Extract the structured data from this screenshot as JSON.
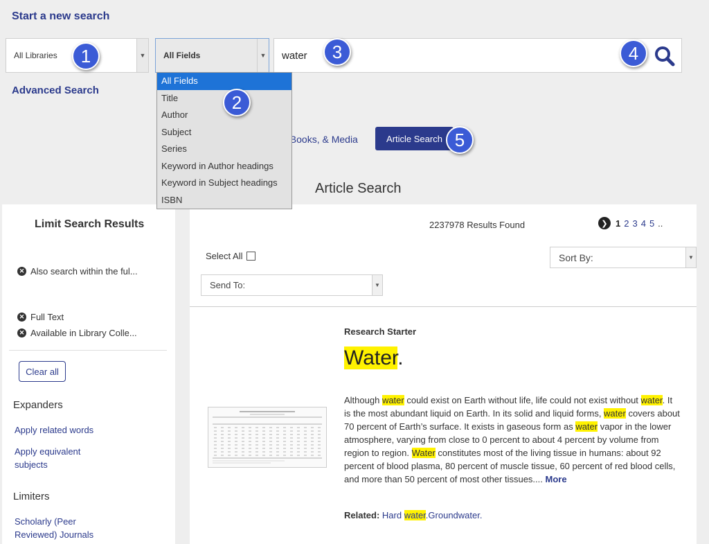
{
  "header": {
    "start_new_search": "Start a new search",
    "advanced_search": "Advanced Search"
  },
  "search": {
    "library_select": "All Libraries",
    "field_select": "All Fields",
    "query": "water",
    "field_options": [
      "All Fields",
      "Title",
      "Author",
      "Subject",
      "Series",
      "Keyword in Author headings",
      "Keyword in Subject headings",
      "ISBN"
    ]
  },
  "badges": [
    "1",
    "2",
    "3",
    "4",
    "5"
  ],
  "tabs": {
    "books_tab_partial": "eBooks, & Media",
    "article_search": "Article Search"
  },
  "section_title": "Article Search",
  "sidebar": {
    "title": "Limit Search Results",
    "chips": [
      "Also search within the ful...",
      "Full Text",
      "Available in Library Colle..."
    ],
    "clear_all": "Clear all",
    "expanders_heading": "Expanders",
    "expanders": [
      "Apply related words",
      "Apply equivalent subjects"
    ],
    "limiters_heading": "Limiters",
    "limiters": [
      "Scholarly (Peer Reviewed) Journals"
    ]
  },
  "results": {
    "count_text": "2237978 Results Found",
    "pages": [
      "1",
      "2",
      "3",
      "4",
      "5",
      ".."
    ],
    "select_all": "Select All",
    "sort_by": "Sort By:",
    "send_to": "Send To:"
  },
  "research_starter": {
    "label": "Research Starter",
    "title_word": "Water",
    "title_suffix": ".",
    "more": "More",
    "related_label": "Related:",
    "related_1_pre": "Hard ",
    "related_1_hl": "water",
    "related_1_post": ".",
    "related_2": "Groundwater."
  },
  "colors": {
    "accent": "#2b3a8c",
    "badge": "#3b5bd6",
    "highlight": "#fff200",
    "dropdown_selected": "#1e73d7"
  }
}
